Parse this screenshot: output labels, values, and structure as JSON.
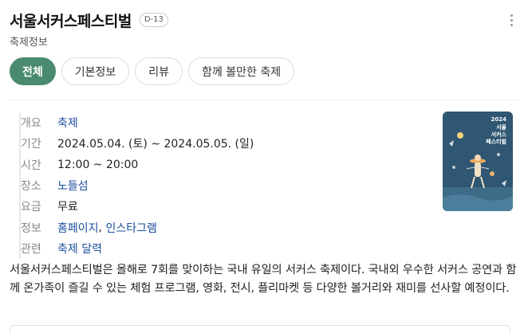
{
  "header": {
    "title": "서울서커스페스티벌",
    "dday": "D-13",
    "subtitle": "축제정보"
  },
  "tabs": [
    {
      "label": "전체",
      "active": true
    },
    {
      "label": "기본정보",
      "active": false
    },
    {
      "label": "리뷰",
      "active": false
    },
    {
      "label": "함께 볼만한 축제",
      "active": false
    }
  ],
  "info": {
    "type": {
      "label": "개요",
      "value": "축제"
    },
    "period": {
      "label": "기간",
      "value": "2024.05.04. (토) ~  2024.05.05. (일)"
    },
    "time": {
      "label": "시간",
      "value": "12:00 ~ 20:00"
    },
    "place": {
      "label": "장소",
      "value": "노들섬"
    },
    "fee": {
      "label": "요금",
      "value": "무료"
    },
    "links": {
      "label": "정보",
      "homepage": "홈페이지",
      "instagram": "인스타그램"
    },
    "related": {
      "label": "관련",
      "value": "축제 달력"
    }
  },
  "poster": {
    "year": "2024",
    "title_lines": [
      "서울",
      "서커스",
      "페스티벌"
    ],
    "bg_color": "#2f5673"
  },
  "description": "서울서커스페스티벌은 올해로 7회를 맞이하는 국내 유일의 서커스 축제이다. 국내외 우수한 서커스 공연과 함께 온가족이 즐길 수 있는 체험 프로그램, 영화, 전시, 플리마켓 등 다양한 볼거리와 재미를 선사할 예정이다.",
  "colors": {
    "accent": "#4a8b6f",
    "link": "#1a4d9c"
  }
}
